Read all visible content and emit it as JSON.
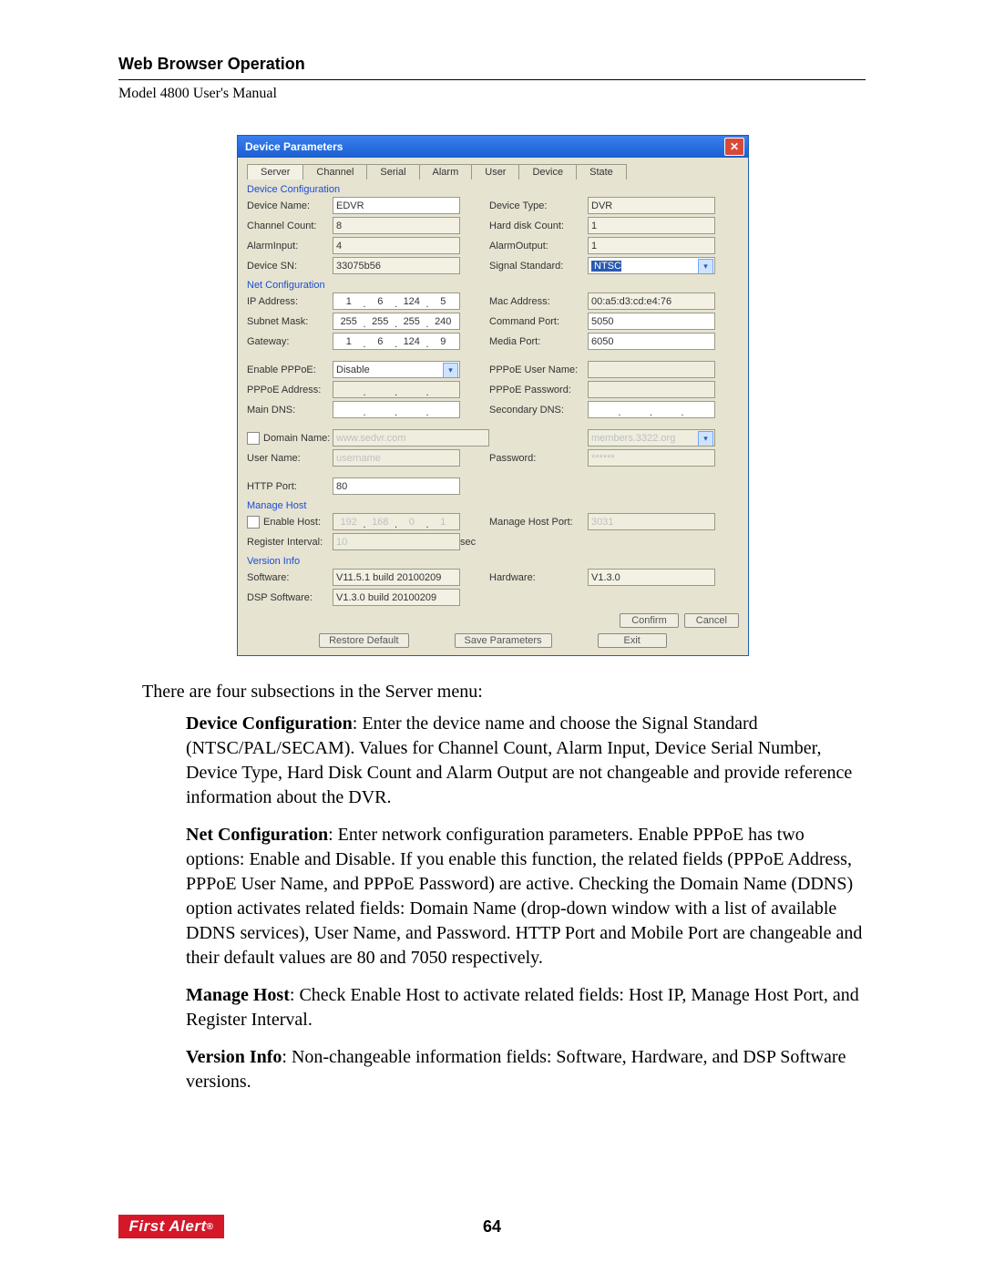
{
  "header": {
    "section": "Web Browser Operation",
    "subtitle": "Model 4800 User's Manual"
  },
  "dialog": {
    "title": "Device Parameters",
    "tabs": [
      "Server",
      "Channel",
      "Serial",
      "Alarm",
      "User",
      "Device",
      "State"
    ],
    "active_tab": "Server",
    "groups": {
      "devcfg": {
        "title": "Device Configuration",
        "device_name_lbl": "Device Name:",
        "device_name": "EDVR",
        "device_type_lbl": "Device Type:",
        "device_type": "DVR",
        "channel_count_lbl": "Channel Count:",
        "channel_count": "8",
        "hdd_lbl": "Hard disk Count:",
        "hdd": "1",
        "alarm_in_lbl": "AlarmInput:",
        "alarm_in": "4",
        "alarm_out_lbl": "AlarmOutput:",
        "alarm_out": "1",
        "sn_lbl": "Device SN:",
        "sn": "33075b56",
        "signal_lbl": "Signal Standard:",
        "signal": "NTSC"
      },
      "netcfg": {
        "title": "Net Configuration",
        "ip_lbl": "IP Address:",
        "ip": [
          "1",
          "6",
          "124",
          "5"
        ],
        "mac_lbl": "Mac Address:",
        "mac": "00:a5:d3:cd:e4:76",
        "mask_lbl": "Subnet Mask:",
        "mask": [
          "255",
          "255",
          "255",
          "240"
        ],
        "cmd_lbl": "Command Port:",
        "cmd": "5050",
        "gw_lbl": "Gateway:",
        "gw": [
          "1",
          "6",
          "124",
          "9"
        ],
        "media_lbl": "Media Port:",
        "media": "6050",
        "pppoe_en_lbl": "Enable PPPoE:",
        "pppoe_en": "Disable",
        "pppoe_user_lbl": "PPPoE User Name:",
        "pppoe_addr_lbl": "PPPoE Address:",
        "pppoe_addr": [
          "",
          "",
          "",
          ""
        ],
        "pppoe_pwd_lbl": "PPPoE Password:",
        "maindns_lbl": "Main DNS:",
        "maindns": [
          "",
          "",
          "",
          ""
        ],
        "secdns_lbl": "Secondary DNS:",
        "secdns": [
          "",
          "",
          "",
          ""
        ],
        "domain_lbl": "Domain Name:",
        "domain": "www.sedvr.com",
        "domain_suffix": "members.3322.org",
        "username_lbl": "User Name:",
        "username_ph": "username",
        "password_lbl": "Password:",
        "password": "******",
        "http_lbl": "HTTP Port:",
        "http": "80"
      },
      "mhost": {
        "title": "Manage Host",
        "enable_lbl": "Enable Host:",
        "host_ip": [
          "192",
          "168",
          "0",
          "1"
        ],
        "port_lbl": "Manage Host Port:",
        "port": "3031",
        "interval_lbl": "Register Interval:",
        "interval": "10",
        "interval_unit": "sec"
      },
      "ver": {
        "title": "Version Info",
        "sw_lbl": "Software:",
        "sw": "V11.5.1 build 20100209",
        "hw_lbl": "Hardware:",
        "hw": "V1.3.0",
        "dsp_lbl": "DSP Software:",
        "dsp": "V1.3.0 build 20100209"
      }
    },
    "buttons": {
      "confirm": "Confirm",
      "cancel": "Cancel",
      "restore": "Restore Default",
      "save": "Save Parameters",
      "exit": "Exit"
    }
  },
  "body": {
    "lead": "There are four subsections in the Server menu:",
    "p1_b": "Device Configuration",
    "p1": ": Enter the device name and choose the Signal Standard (NTSC/PAL/SECAM). Values for Channel Count, Alarm Input, Device Serial Number, Device Type, Hard Disk Count and Alarm Output are not changeable and provide reference information about the DVR.",
    "p2_b": "Net Configuration",
    "p2": ": Enter network configuration parameters. Enable PPPoE has two options: Enable and Disable. If you enable this function, the related fields (PPPoE Address, PPPoE User Name, and PPPoE Password) are active. Checking the Domain Name (DDNS) option activates related fields: Domain Name (drop-down window with a list of available DDNS services), User Name, and Password. HTTP Port and Mobile Port are changeable and their default values are 80 and 7050 respectively.",
    "p3_b": "Manage Host",
    "p3": ": Check Enable Host to activate related fields: Host IP, Manage Host Port, and Register Interval.",
    "p4_b": "Version Info",
    "p4": ": Non-changeable information fields: Software, Hardware, and DSP Software versions."
  },
  "footer": {
    "logo": "First Alert",
    "page": "64"
  }
}
